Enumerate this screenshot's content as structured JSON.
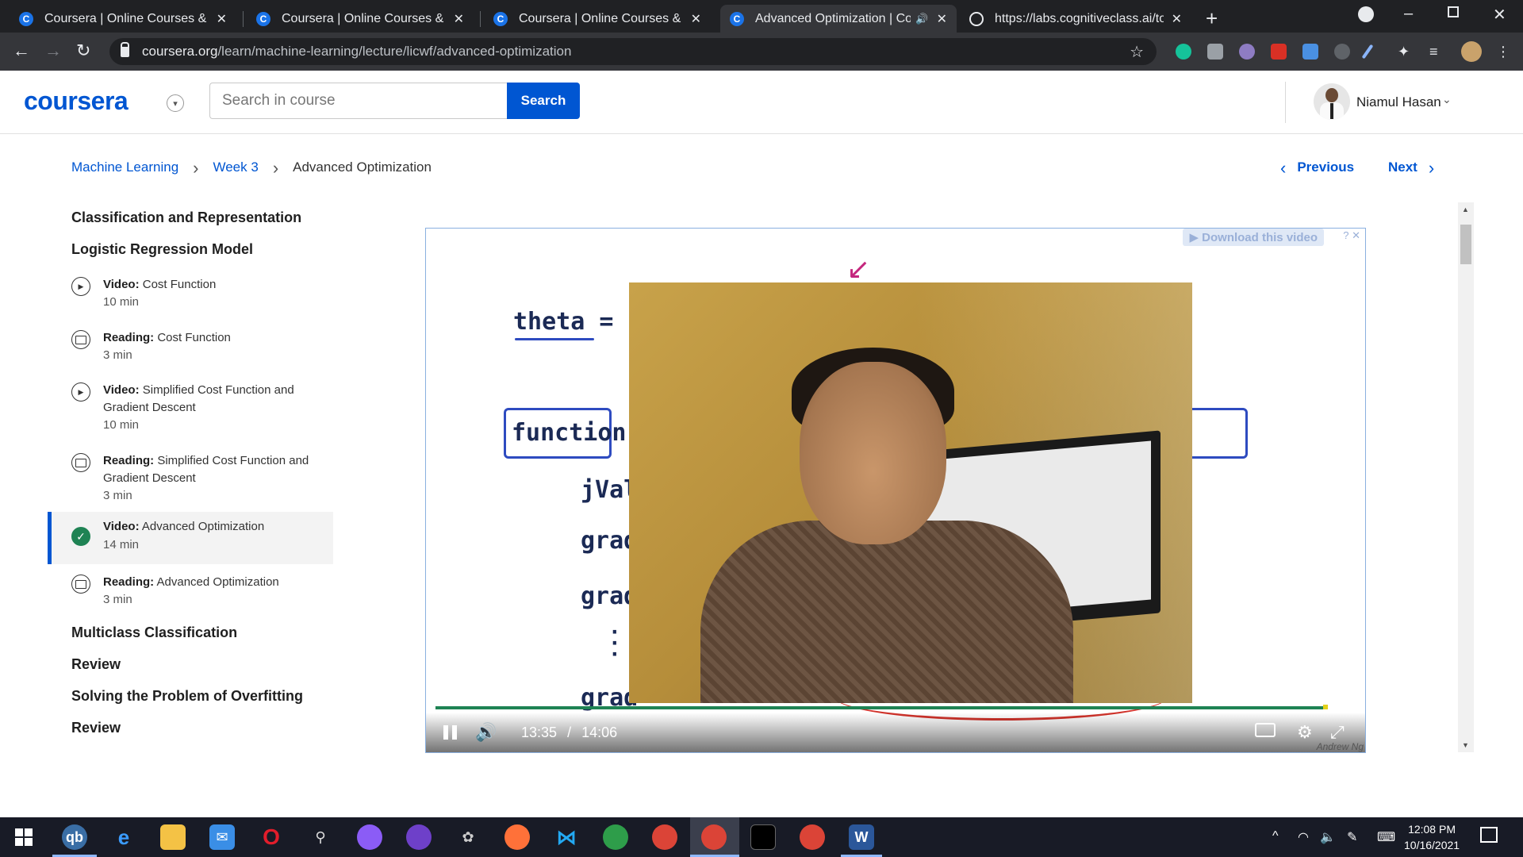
{
  "browser": {
    "tabs": [
      {
        "title": "Coursera | Online Courses & Credentials",
        "active": false,
        "speaker": false
      },
      {
        "title": "Coursera | Online Courses & Credentials",
        "active": false,
        "speaker": false
      },
      {
        "title": "Coursera | Online Courses & Credentials",
        "active": false,
        "speaker": false
      },
      {
        "title": "Advanced Optimization | Coursera",
        "active": true,
        "speaker": true
      },
      {
        "title": "https://labs.cognitiveclass.ai/tools",
        "active": false,
        "speaker": false
      }
    ],
    "url_domain": "coursera.org",
    "url_path": "/learn/machine-learning/lecture/licwf/advanced-optimization"
  },
  "header": {
    "logo": "coursera",
    "search_placeholder": "Search in course",
    "search_button": "Search",
    "user_name": "Niamul Hasan"
  },
  "breadcrumb": {
    "course": "Machine Learning",
    "week": "Week 3",
    "current": "Advanced Optimization"
  },
  "lesson_nav": {
    "previous": "Previous",
    "next": "Next"
  },
  "sidebar": {
    "sections": [
      "Classification and Representation",
      "Logistic Regression Model",
      "Multiclass Classification",
      "Review",
      "Solving the Problem of Overfitting",
      "Review"
    ],
    "items": [
      {
        "kind": "Video:",
        "title": "Cost Function",
        "duration": "10 min",
        "icon": "play-icon",
        "active": false
      },
      {
        "kind": "Reading:",
        "title": "Cost Function",
        "duration": "3 min",
        "icon": "book-icon",
        "active": false
      },
      {
        "kind": "Video:",
        "title": "Simplified Cost Function and Gradient Descent",
        "duration": "10 min",
        "icon": "play-icon",
        "active": false
      },
      {
        "kind": "Reading:",
        "title": "Simplified Cost Function and Gradient Descent",
        "duration": "3 min",
        "icon": "book-icon",
        "active": false
      },
      {
        "kind": "Video:",
        "title": "Advanced Optimization",
        "duration": "14 min",
        "icon": "check-icon",
        "active": true
      },
      {
        "kind": "Reading:",
        "title": "Advanced Optimization",
        "duration": "3 min",
        "icon": "book-icon",
        "active": false
      }
    ]
  },
  "video": {
    "download_label": "Download this video",
    "slide_lines": [
      "theta =",
      "function",
      "jVal",
      "grad",
      "grad",
      "grad"
    ],
    "current_time": "13:35",
    "time_sep": "/",
    "total_time": "14:06",
    "progress_fraction": 0.966,
    "watermark": "Andrew Ng"
  },
  "taskbar": {
    "clock_time": "12:08 PM",
    "clock_date": "10/16/2021"
  },
  "colors": {
    "brand": "#0056d2",
    "complete": "#1f8354",
    "chrome_dark": "#202124"
  }
}
